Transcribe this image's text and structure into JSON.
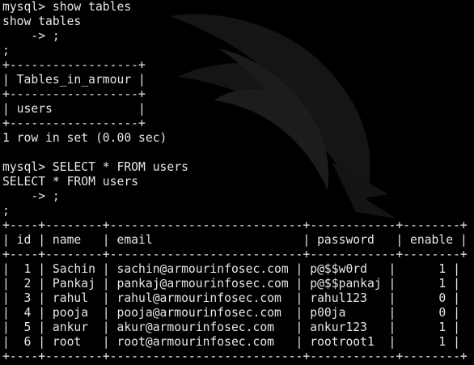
{
  "terminal": {
    "lines": [
      "mysql> show tables",
      "show tables",
      "    -> ;",
      ";",
      "+------------------+",
      "| Tables_in_armour |",
      "+------------------+",
      "| users            |",
      "+------------------+",
      "1 row in set (0.00 sec)",
      "",
      "mysql> SELECT * FROM users",
      "SELECT * FROM users",
      "    -> ;",
      ";",
      "+----+--------+---------------------------+------------+--------+",
      "| id | name   | email                     | password   | enable |",
      "+----+--------+---------------------------+------------+--------+",
      "|  1 | Sachin | sachin@armourinfosec.com | p@$$w0rd   |      1 |",
      "|  2 | Pankaj | pankaj@armourinfosec.com | p@$$pankaj |      1 |",
      "|  3 | rahul  | rahul@armourinfosec.com  | rahul123   |      0 |",
      "|  4 | pooja  | pooja@armourinfosec.com  | p00ja      |      0 |",
      "|  5 | ankur  | akur@armourinfosec.com   | ankur123   |      1 |",
      "|  6 | root   | root@armourinfosec.com   | rootroot1  |      1 |",
      "+----+--------+---------------------------+------------+--------+"
    ]
  },
  "colors": {
    "background": "#000000",
    "text": "#e6e6e6",
    "watermark": "#1a1a1a"
  },
  "icons": {
    "watermark": "dragon-logo-watermark"
  }
}
